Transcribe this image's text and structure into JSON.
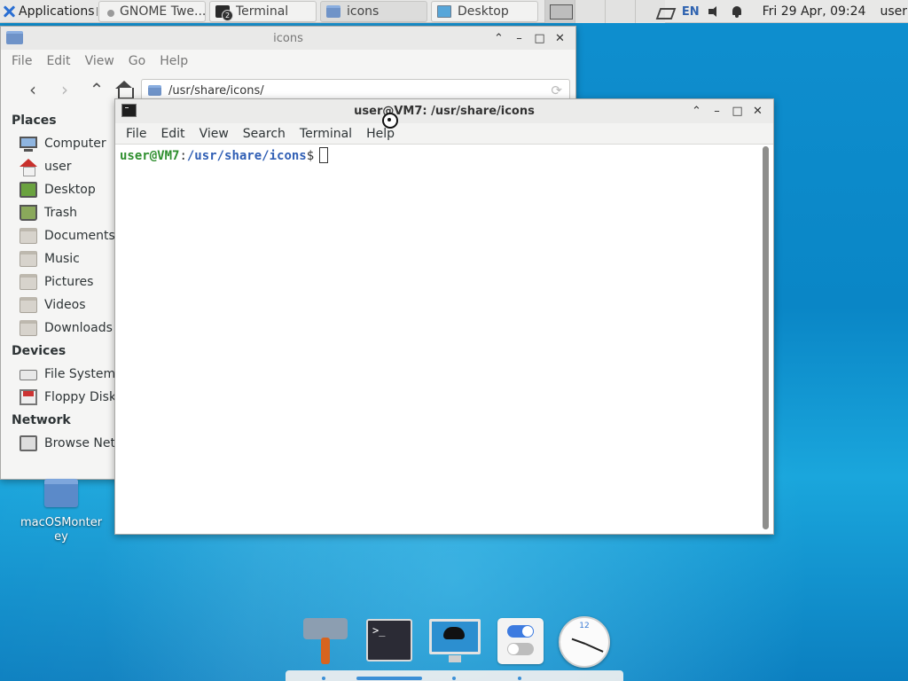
{
  "top_panel": {
    "applications_label": "Applications",
    "tasks": [
      {
        "label": "GNOME Twe...",
        "icon": "gnome-tweaks-icon"
      },
      {
        "label": "Terminal",
        "icon": "terminal-icon",
        "badge": "2"
      },
      {
        "label": "icons",
        "icon": "folder-icon"
      },
      {
        "label": "Desktop",
        "icon": "desktop-icon"
      }
    ],
    "tray": {
      "language": "EN",
      "clock": "Fri 29 Apr, 09:24",
      "user": "user"
    }
  },
  "file_manager": {
    "title": "icons",
    "menu": [
      "File",
      "Edit",
      "View",
      "Go",
      "Help"
    ],
    "location": "/usr/share/icons/",
    "sidebar": {
      "places_header": "Places",
      "places": [
        "Computer",
        "user",
        "Desktop",
        "Trash",
        "Documents",
        "Music",
        "Pictures",
        "Videos",
        "Downloads"
      ],
      "devices_header": "Devices",
      "devices": [
        "File System",
        "Floppy Disk"
      ],
      "network_header": "Network",
      "network": [
        "Browse Network"
      ]
    }
  },
  "terminal": {
    "title": "user@VM7: /usr/share/icons",
    "menu": [
      "File",
      "Edit",
      "View",
      "Search",
      "Terminal",
      "Help"
    ],
    "prompt_user": "user@VM7",
    "prompt_colon": ":",
    "prompt_path": "/usr/share/icons",
    "prompt_sign": "$"
  },
  "desktop": {
    "icon_label": "macOSMonterey"
  },
  "dock": {
    "apps": [
      "catfish-search-icon",
      "terminal-icon",
      "mousepad-desktop-icon",
      "settings-toggle-icon",
      "clock-icon"
    ],
    "clock_number": "12"
  },
  "colors": {
    "desktop_bg": "#0a86c6",
    "prompt_user": "#2f8f2f",
    "prompt_path": "#305fb5",
    "accent": "#3b8fd6"
  }
}
